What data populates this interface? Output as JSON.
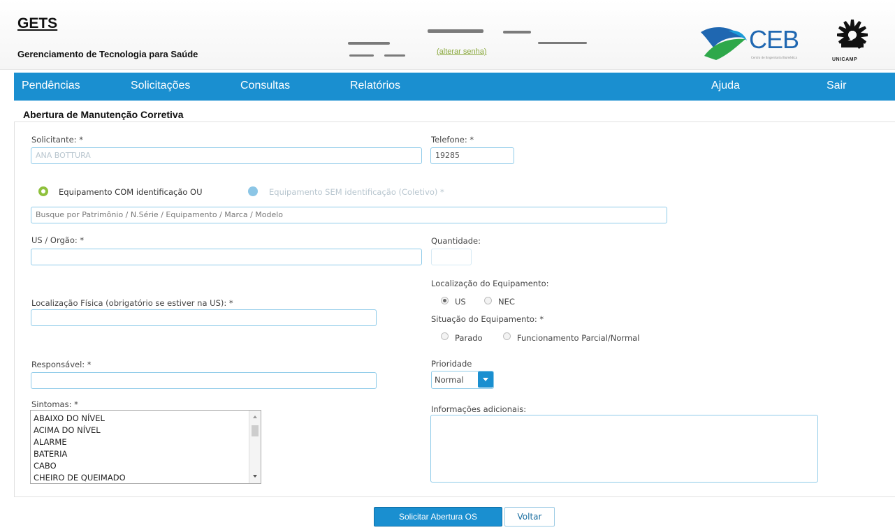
{
  "header": {
    "title": "GETS",
    "subtitle": "Gerenciamento de Tecnologia para Saúde",
    "change_password_link": "(alterar senha)",
    "ceb_logo_text": "CEB",
    "ceb_tagline": "Centro de Engenharia Biomédica",
    "unicamp_logo_text": "UNICAMP"
  },
  "nav": {
    "items": [
      "Pendências",
      "Solicitações",
      "Consultas",
      "Relatórios"
    ],
    "help": "Ajuda",
    "logout": "Sair"
  },
  "page": {
    "title": "Abertura de Manutenção Corretiva"
  },
  "form": {
    "solicitante_label": "Solicitante: *",
    "solicitante_value": "ANA BOTTURA",
    "telefone_label": "Telefone: *",
    "telefone_value": "19285",
    "equip_com_label": "Equipamento COM identificação OU",
    "equip_sem_label": "Equipamento SEM identificação (Coletivo) *",
    "search_placeholder": "Busque por Patrimônio / N.Série / Equipamento / Marca / Modelo",
    "us_orgao_label": "US / Orgão: *",
    "quantidade_label": "Quantidade:",
    "localizacao_equip_label": "Localização do Equipamento:",
    "loc_option_us": "US",
    "loc_option_nec": "NEC",
    "loc_selected": "US",
    "localizacao_fisica_label": "Localização Física (obrigatório se estiver na US): *",
    "situacao_label": "Situação do Equipamento: *",
    "situacao_option_parado": "Parado",
    "situacao_option_func": "Funcionamento Parcial/Normal",
    "responsavel_label": "Responsável: *",
    "prioridade_label": "Prioridade",
    "prioridade_value": "Normal",
    "sintomas_label": "Sintomas: *",
    "sintomas_options": [
      "ABAIXO DO NÍVEL",
      "ACIMA DO NÍVEL",
      "ALARME",
      "BATERIA",
      "CABO",
      "CHEIRO DE QUEIMADO"
    ],
    "info_adicionais_label": "Informações adicionais:"
  },
  "actions": {
    "submit": "Solicitar Abertura OS",
    "back": "Voltar"
  },
  "colors": {
    "nav_bg": "#1a8fd0",
    "input_border": "#8fcbe9",
    "radio_green": "#8fc13d",
    "ceb_green": "#2ea84a",
    "ceb_blue": "#1f67b1"
  }
}
